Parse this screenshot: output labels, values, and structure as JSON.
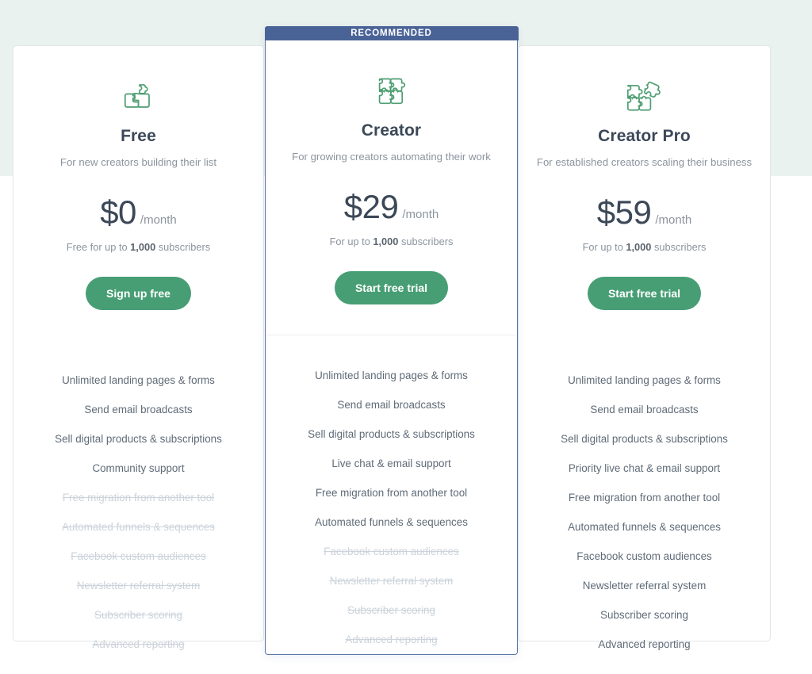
{
  "theme": {
    "band_color": "#eaf2ef",
    "accent_green": "#479e74",
    "recommend_blue": "#4a6397",
    "icon_green": "#4f9e73",
    "text_dark": "#3c4858",
    "text_muted": "#8b949e",
    "text_disabled": "#ccd3da"
  },
  "plans": [
    {
      "id": "free",
      "recommended_label": null,
      "icon": "puzzle-two-pieces-icon",
      "name": "Free",
      "tagline": "For new creators building their list",
      "price": "$0",
      "period": "/month",
      "note_prefix": "Free for up to ",
      "note_bold": "1,000",
      "note_suffix": " subscribers",
      "cta": "Sign up free",
      "features": [
        {
          "label": "Unlimited landing pages & forms",
          "included": true
        },
        {
          "label": "Send email broadcasts",
          "included": true
        },
        {
          "label": "Sell digital products & subscriptions",
          "included": true
        },
        {
          "label": "Community support",
          "included": true
        },
        {
          "label": "Free migration from another tool",
          "included": false
        },
        {
          "label": "Automated funnels & sequences",
          "included": false
        },
        {
          "label": "Facebook custom audiences",
          "included": false
        },
        {
          "label": "Newsletter referral system",
          "included": false
        },
        {
          "label": "Subscriber scoring",
          "included": false
        },
        {
          "label": "Advanced reporting",
          "included": false
        }
      ]
    },
    {
      "id": "creator",
      "recommended_label": "RECOMMENDED",
      "icon": "puzzle-four-pieces-icon",
      "name": "Creator",
      "tagline": "For growing creators automating their work",
      "price": "$29",
      "period": "/month",
      "note_prefix": "For up to ",
      "note_bold": "1,000",
      "note_suffix": " subscribers",
      "cta": "Start free trial",
      "features": [
        {
          "label": "Unlimited landing pages & forms",
          "included": true
        },
        {
          "label": "Send email broadcasts",
          "included": true
        },
        {
          "label": "Sell digital products & subscriptions",
          "included": true
        },
        {
          "label": "Live chat & email support",
          "included": true
        },
        {
          "label": "Free migration from another tool",
          "included": true
        },
        {
          "label": "Automated funnels & sequences",
          "included": true
        },
        {
          "label": "Facebook custom audiences",
          "included": false
        },
        {
          "label": "Newsletter referral system",
          "included": false
        },
        {
          "label": "Subscriber scoring",
          "included": false
        },
        {
          "label": "Advanced reporting",
          "included": false
        }
      ]
    },
    {
      "id": "creator-pro",
      "recommended_label": null,
      "icon": "puzzle-detached-piece-icon",
      "name": "Creator Pro",
      "tagline": "For established creators scaling their business",
      "price": "$59",
      "period": "/month",
      "note_prefix": "For up to ",
      "note_bold": "1,000",
      "note_suffix": " subscribers",
      "cta": "Start free trial",
      "features": [
        {
          "label": "Unlimited landing pages & forms",
          "included": true
        },
        {
          "label": "Send email broadcasts",
          "included": true
        },
        {
          "label": "Sell digital products & subscriptions",
          "included": true
        },
        {
          "label": "Priority live chat & email support",
          "included": true
        },
        {
          "label": "Free migration from another tool",
          "included": true
        },
        {
          "label": "Automated funnels & sequences",
          "included": true
        },
        {
          "label": "Facebook custom audiences",
          "included": true
        },
        {
          "label": "Newsletter referral system",
          "included": true
        },
        {
          "label": "Subscriber scoring",
          "included": true
        },
        {
          "label": "Advanced reporting",
          "included": true
        }
      ]
    }
  ]
}
